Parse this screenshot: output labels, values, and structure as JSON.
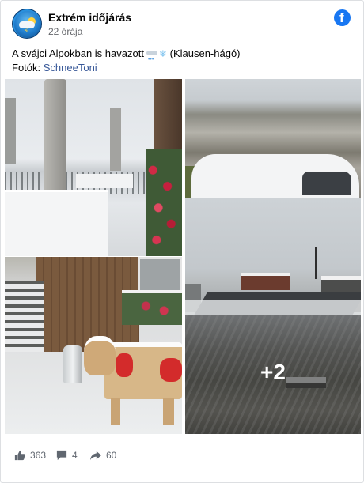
{
  "post": {
    "page_name": "Extrém időjárás",
    "timestamp": "22 órája",
    "text_main": "A svájci Alpokban is havazott",
    "text_location": " (Klausen-hágó)",
    "photos_label": "Fotók: ",
    "photographer": "SchneeToni",
    "platform_logo_icon": "facebook-logo-icon"
  },
  "gallery": {
    "more_count": "+2",
    "photos": [
      {
        "subject": "snowy-terrace-photo"
      },
      {
        "subject": "snowy-car-mountain-photo"
      },
      {
        "subject": "foggy-pass-hotel-photo"
      },
      {
        "subject": "cow-bench-snow-photo"
      },
      {
        "subject": "snowy-slope-photo"
      }
    ]
  },
  "reactions": {
    "likes": "363",
    "comments": "4",
    "shares": "60"
  },
  "colors": {
    "brand_blue": "#1877f2",
    "link": "#385898",
    "muted": "#65676b"
  }
}
